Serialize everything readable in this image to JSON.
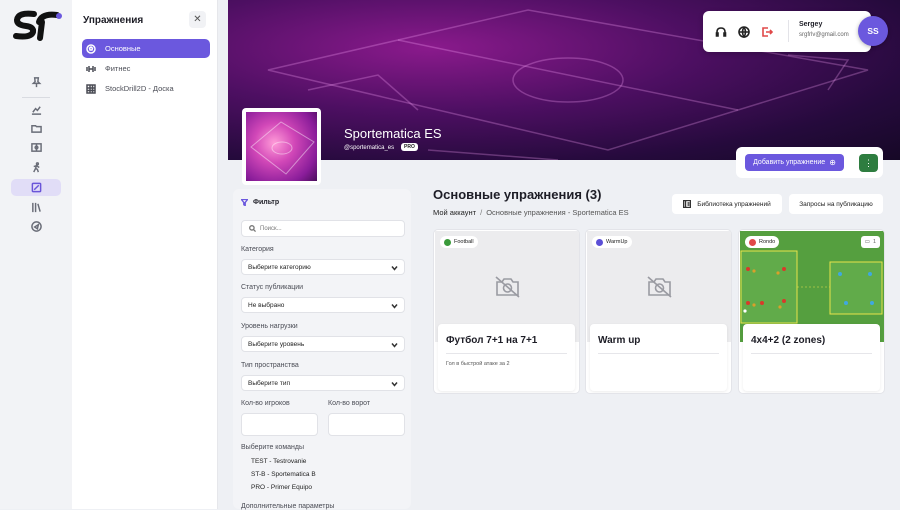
{
  "app": {
    "logo_text": "ST"
  },
  "rail": {
    "icons": [
      "pin-icon",
      "chart-icon",
      "folder-icon",
      "board-icon",
      "runner-icon",
      "drill-icon",
      "library-icon",
      "send-icon"
    ]
  },
  "sidebar": {
    "title": "Упражнения",
    "items": [
      {
        "label": "Основные",
        "icon": "soccer-ball-icon",
        "active": true
      },
      {
        "label": "Фитнес",
        "icon": "dumbbell-icon",
        "active": false
      },
      {
        "label": "StockDrill2D - Доска",
        "icon": "grid-icon",
        "active": false
      }
    ]
  },
  "user": {
    "name": "Sergey",
    "email": "srgfrlv@gmail.com",
    "initials": "SS"
  },
  "profile": {
    "name": "Sportematica ES",
    "handle": "@sportematica_es",
    "badge": "PRO"
  },
  "actions": {
    "add_label": "Добавить упражнение",
    "more_label": "⋮"
  },
  "filter": {
    "title": "Фильтр",
    "search_placeholder": "Поиск...",
    "category_label": "Категория",
    "category_value": "Выберите категорию",
    "status_label": "Статус публикации",
    "status_value": "Не выбрано",
    "load_label": "Уровень нагрузки",
    "load_value": "Выберите уровень",
    "space_label": "Тип пространства",
    "space_value": "Выберите тип",
    "players_label": "Кол-во игроков",
    "goals_label": "Кол-во ворот",
    "teams_label": "Выберите команды",
    "teams": [
      "TEST - Testrovanie",
      "ST-B - Sportematica B",
      "PRO - Primer Equipo"
    ],
    "extra_label": "Дополнительные параметры"
  },
  "main": {
    "title": "Основные упражнения (3)",
    "breadcrumb": {
      "root": "Мой аккаунт",
      "separator": "/",
      "current": "Основные упражнения - Sportematica ES"
    },
    "library_button": "Библиотека упражнений",
    "requests_button": "Запросы на публикацию"
  },
  "cards": [
    {
      "tag": "Football",
      "tag_color": "#3a9a3a",
      "title": "Футбол 7+1 на 7+1",
      "description": "Гол в быстрой атаке за 2",
      "has_image": false
    },
    {
      "tag": "WarmUp",
      "tag_color": "#5b4fd6",
      "title": "Warm up",
      "description": "",
      "has_image": false
    },
    {
      "tag": "Rondo",
      "tag_color": "#e04848",
      "title": "4x4+2 (2 zones)",
      "description": "",
      "has_image": true,
      "count": "1"
    }
  ],
  "colors": {
    "accent": "#6b58de",
    "green": "#2e7d40"
  }
}
